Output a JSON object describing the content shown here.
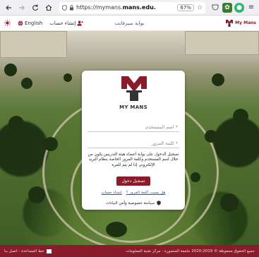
{
  "browser": {
    "back_icon": "arrow-left-icon",
    "forward_icon": "arrow-right-icon",
    "reload_icon": "reload-icon",
    "home_icon": "home-icon",
    "url_prefix": "https://mymans.",
    "url_host": "mans.edu.",
    "zoom": "67%"
  },
  "header": {
    "language_link": "English",
    "create_account": "إنشاء حساب",
    "center_text": "بوابة سيرفانت",
    "brand": "My Mans"
  },
  "login": {
    "logo_text": "MY MANS",
    "username_placeholder": "اسم المستخدم *",
    "password_placeholder": "كلمة المرور *",
    "note": "تسجيل الدخول على بوابة أعضاء هيئة التدريس يكون من خلال اسم المستخدم وكلمة المرور الخاصة بنظام البريد الإلكتروني إذا لم يتم",
    "note_extra": "للمرة",
    "login_button": "تسجيل دخول",
    "forgot_link": "هل نسيت كلمة المرور ؟",
    "register_link": "إنشاء حساب",
    "privacy_text": "سياسة خصوصية وأمن البيانات"
  },
  "footer": {
    "left_text": "خط المساعدة - اتصل بنا",
    "right_text": "جميع الحقوق محفوظة © 2019-2020 جامعة المنصورة - مركز تقنية المعلومات"
  },
  "colors": {
    "brand": "#8a1b2b",
    "link": "#2a5bbf"
  }
}
